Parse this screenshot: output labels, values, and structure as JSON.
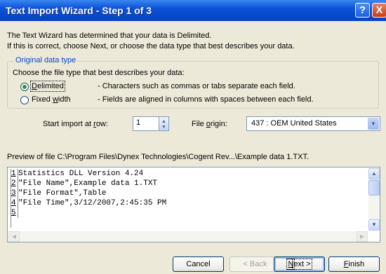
{
  "window": {
    "title": "Text Import Wizard - Step 1 of 3",
    "help_glyph": "?",
    "close_glyph": "X"
  },
  "intro": {
    "line1": "The Text Wizard has determined that your data is Delimited.",
    "line2": "If this is correct, choose Next, or choose the data type that best describes your data."
  },
  "data_type": {
    "legend": "Original data type",
    "prompt": "Choose the file type that best describes your data:",
    "options": [
      {
        "label_ul": "D",
        "label_rest": "elimited",
        "desc": "- Characters such as commas or tabs separate each field.",
        "selected": true
      },
      {
        "label_pre": "Fixed ",
        "label_ul": "w",
        "label_rest": "idth",
        "desc": "- Fields are aligned in columns with spaces between each field.",
        "selected": false
      }
    ]
  },
  "start_row": {
    "label_pre": "Start import at ",
    "label_ul": "r",
    "label_rest": "ow:",
    "value": "1"
  },
  "file_origin": {
    "label_pre": "File ",
    "label_ul": "o",
    "label_rest": "rigin:",
    "value": "437 : OEM United States"
  },
  "preview": {
    "caption": "Preview of file C:\\Program Files\\Dynex Technologies\\Cogent Rev...\\Example data 1.TXT.",
    "lines": [
      {
        "num": "1",
        "text": "Statistics DLL Version 4.24"
      },
      {
        "num": "2",
        "text": "\"File Name\",Example data 1.TXT"
      },
      {
        "num": "3",
        "text": "\"File Format\",Table"
      },
      {
        "num": "4",
        "text": "\"File Time\",3/12/2007,2:45:35 PM"
      },
      {
        "num": "5",
        "text": ""
      }
    ]
  },
  "buttons": {
    "cancel": "Cancel",
    "back": "< Back",
    "next_ul": "N",
    "next_rest": "ext >",
    "finish_ul": "F",
    "finish_rest": "inish"
  }
}
